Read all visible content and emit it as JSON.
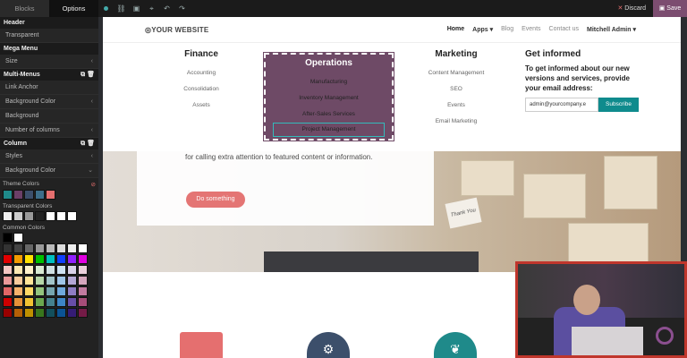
{
  "panel": {
    "tabs": [
      "Blocks",
      "Options"
    ],
    "header_title": "Header",
    "transparent_label": "Transparent",
    "mega_menu_title": "Mega Menu",
    "size_label": "Size",
    "multi_menus_title": "Multi-Menus",
    "link_anchor_label": "Link Anchor",
    "bg_color_label": "Background Color",
    "background_label": "Background",
    "num_columns_label": "Number of columns",
    "column_title": "Column",
    "styles_label": "Styles",
    "bg_color_label2": "Background Color",
    "theme_colors_label": "Theme Colors",
    "transparent_colors_label": "Transparent Colors",
    "common_colors_label": "Common Colors",
    "theme_colors": [
      "#1f8a8a",
      "#6b3f67",
      "#3c4f6b",
      "#3d6e8a",
      "#e56f6f"
    ],
    "common_colors": [
      [
        "#000000",
        "#ffffff"
      ],
      [
        "#333333",
        "#444444",
        "#666666",
        "#999999",
        "#bbbbbb",
        "#dddddd",
        "#eeeeee",
        "#ffffff"
      ],
      [
        "#e00000",
        "#f39b00",
        "#ffe000",
        "#00c000",
        "#00c0c0",
        "#1040ff",
        "#9020ff",
        "#e000e0"
      ],
      [
        "#f4c7c3",
        "#fce8b2",
        "#fff2cc",
        "#d9ead3",
        "#d0e0e3",
        "#cfe2f3",
        "#d9d2e9",
        "#ead1dc"
      ],
      [
        "#ea9999",
        "#f9cb9c",
        "#ffe599",
        "#b6d7a8",
        "#a2c4c9",
        "#9fc5e8",
        "#b4a7d6",
        "#d5a6bd"
      ],
      [
        "#e06666",
        "#f6b26b",
        "#ffd966",
        "#93c47d",
        "#76a5af",
        "#6fa8dc",
        "#8e7cc3",
        "#c27ba0"
      ],
      [
        "#cc0000",
        "#e69138",
        "#f1c232",
        "#6aa84f",
        "#45818e",
        "#3d85c6",
        "#674ea7",
        "#a64d79"
      ],
      [
        "#990000",
        "#b45f06",
        "#bf9000",
        "#38761d",
        "#134f5c",
        "#0b5394",
        "#351c75",
        "#741b47"
      ]
    ]
  },
  "topbar": {
    "discard_label": "Discard",
    "save_label": "Save"
  },
  "site": {
    "logo_text": "YOUR WEBSITE",
    "nav": {
      "home": "Home",
      "apps": "Apps",
      "blog": "Blog",
      "events": "Events",
      "contact": "Contact us",
      "user": "Mitchell Admin"
    },
    "mega": {
      "finance": {
        "title": "Finance",
        "items": [
          "Accounting",
          "Consolidation",
          "Assets"
        ]
      },
      "operations": {
        "title": "Operations",
        "items": [
          "Manufacturing",
          "Inventory Management",
          "After-Sales Services",
          "Project Management"
        ]
      },
      "marketing": {
        "title": "Marketing",
        "items": [
          "Content Management",
          "SEO",
          "Events",
          "Email Marketing"
        ]
      },
      "inform": {
        "title": "Get informed",
        "text": "To get informed about our new versions and services, provide your email address:",
        "email_value": "admin@yourcompany.e",
        "subscribe_label": "Subscribe"
      }
    },
    "hero": {
      "text": "for calling extra attention to featured content or information.",
      "button_label": "Do something",
      "tag_text": "Thank You"
    }
  },
  "colors": {
    "accent": "#7c4d70",
    "teal": "#0f8b8d",
    "coral": "#e56f6f",
    "webcam_border": "#c0362c"
  }
}
